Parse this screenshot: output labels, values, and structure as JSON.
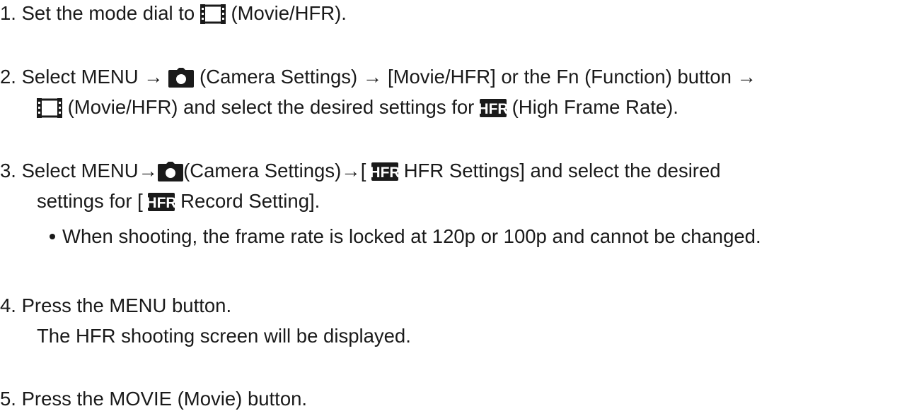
{
  "steps": [
    {
      "number": "1.",
      "text_a": "Set the mode dial to",
      "text_b": "(Movie/HFR)."
    },
    {
      "number": "2.",
      "text_a": "Select MENU →",
      "text_b": "(Camera Settings) → [Movie/HFR] or the Fn (Function) button →",
      "line2_text": "(Movie/HFR) and select the desired settings for",
      "line2_text_b": "(High Frame Rate)."
    },
    {
      "number": "3.",
      "text_a": "Select MENU→",
      "text_b": "(Camera Settings)→[",
      "text_c": "HFR Settings] and select the desired",
      "line2_text_a": "settings for [",
      "line2_text_b": "Record Setting].",
      "bullet": "When shooting, the frame rate is locked at 120p or 100p and cannot be changed."
    },
    {
      "number": "4.",
      "text": "Press the MENU button.",
      "line2_text": "The HFR shooting screen will be displayed."
    },
    {
      "number": "5.",
      "text": "Press the MOVIE (Movie) button."
    }
  ],
  "icons": {
    "movie": "movie-hfr-icon",
    "camera": "camera-settings-icon",
    "hfr": "hfr-icon",
    "hfr_label": "HFR"
  },
  "colors": {
    "text": "#1a1a1a",
    "icon_fill": "#1a1a1a",
    "icon_text": "#ffffff"
  }
}
